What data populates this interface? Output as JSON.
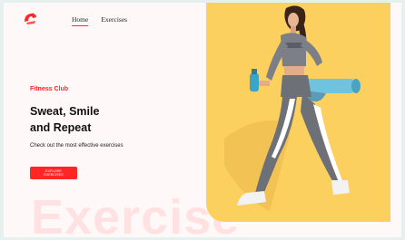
{
  "nav": {
    "home": "Home",
    "exercises": "Exercises"
  },
  "hero": {
    "brand": "Fitness Club",
    "headline_line1": "Sweat, Smile",
    "headline_line2": "and Repeat",
    "subtitle": "Check out the most effective exercises",
    "cta_label": "EXPLORE EXERCISES",
    "watermark": "Exercise"
  },
  "colors": {
    "accent": "#ff2625",
    "hero_bg": "#fcd05f",
    "page_bg": "#fff8f8"
  },
  "icons": {
    "logo": "dumbbell-logo-icon"
  }
}
